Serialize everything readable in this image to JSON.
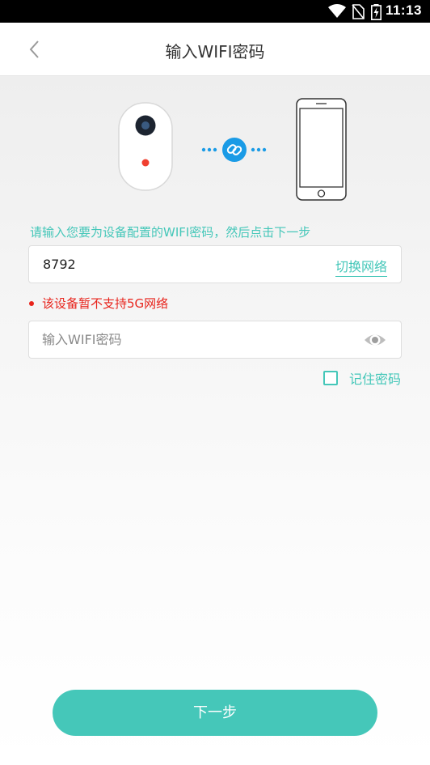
{
  "status_bar": {
    "time": "11:13",
    "icons": [
      "wifi-icon",
      "no-sim-icon",
      "battery-charging-icon"
    ]
  },
  "header": {
    "title": "输入WIFI密码",
    "back_icon": "chevron-left-icon"
  },
  "illustration": {
    "icons": [
      "camera-device-icon",
      "link-icon",
      "phone-icon"
    ],
    "accent": "#1a9be6"
  },
  "form": {
    "hint": "请输入您要为设备配置的WIFI密码，然后点击下一步",
    "ssid_value": "8792",
    "switch_network_label": "切换网络",
    "warning": "该设备暂不支持5G网络",
    "password_placeholder": "输入WIFI密码",
    "password_value": "",
    "eye_icon": "eye-icon",
    "remember_label": "记住密码",
    "remember_checked": false
  },
  "footer": {
    "next_label": "下一步"
  },
  "colors": {
    "accent": "#45c7b9",
    "warning": "#e8241c",
    "status_bar": "#000000"
  }
}
